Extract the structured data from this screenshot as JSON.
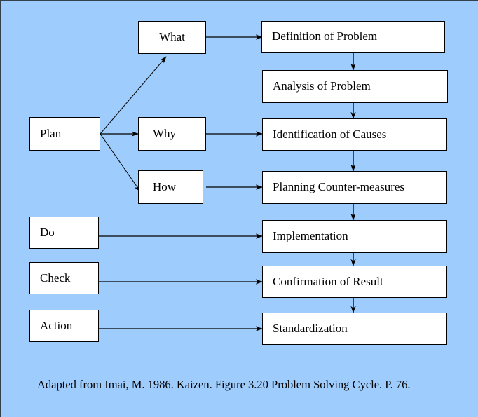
{
  "figure": {
    "background_color": "#9ecdfd",
    "box_fill": "#ffffff",
    "box_border_color": "#000000",
    "caption": "Adapted from Imai, M. 1986. Kaizen.  Figure 3.20 Problem Solving Cycle.  P. 76."
  },
  "pdca_nodes": [
    {
      "label": "Plan"
    },
    {
      "label": "Do"
    },
    {
      "label": "Check"
    },
    {
      "label": "Action"
    }
  ],
  "question_nodes": [
    {
      "label": "What"
    },
    {
      "label": "Why"
    },
    {
      "label": "How"
    }
  ],
  "step_nodes": [
    {
      "label": "Definition of Problem"
    },
    {
      "label": "Analysis of Problem"
    },
    {
      "label": "Identification of Causes"
    },
    {
      "label": "Planning Counter-measures"
    },
    {
      "label": "Implementation"
    },
    {
      "label": "Confirmation of Result"
    },
    {
      "label": "Standardization"
    }
  ]
}
